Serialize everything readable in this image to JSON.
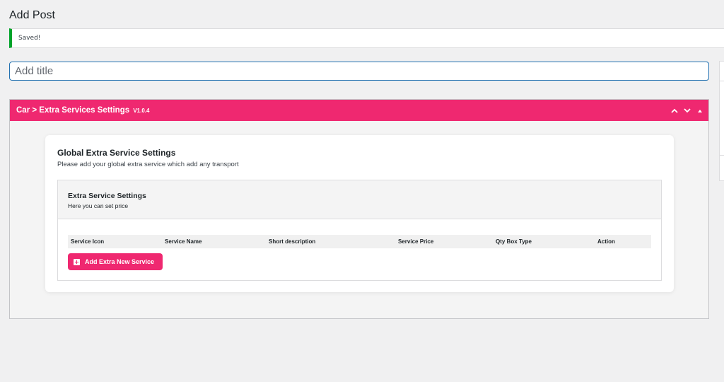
{
  "page": {
    "title": "Add Post"
  },
  "notice": {
    "text": "Saved!",
    "accent": "#00a32a"
  },
  "title_field": {
    "value": "",
    "placeholder": "Add title"
  },
  "metabox": {
    "title": "Car > Extra Services Settings",
    "version": "V1.0.4",
    "header_color": "#ef2870",
    "controls": [
      "chevron-up-icon",
      "chevron-down-icon",
      "triangle-up-icon"
    ]
  },
  "global_settings": {
    "title": "Global Extra Service Settings",
    "subtitle": "Please add your global extra service which add any transport"
  },
  "extra_service": {
    "title": "Extra Service Settings",
    "subtitle": "Here you can set price",
    "columns": [
      "Service Icon",
      "Service Name",
      "Short description",
      "Service Price",
      "Qty Box Type",
      "Action"
    ],
    "add_button_label": "Add Extra New Service"
  }
}
